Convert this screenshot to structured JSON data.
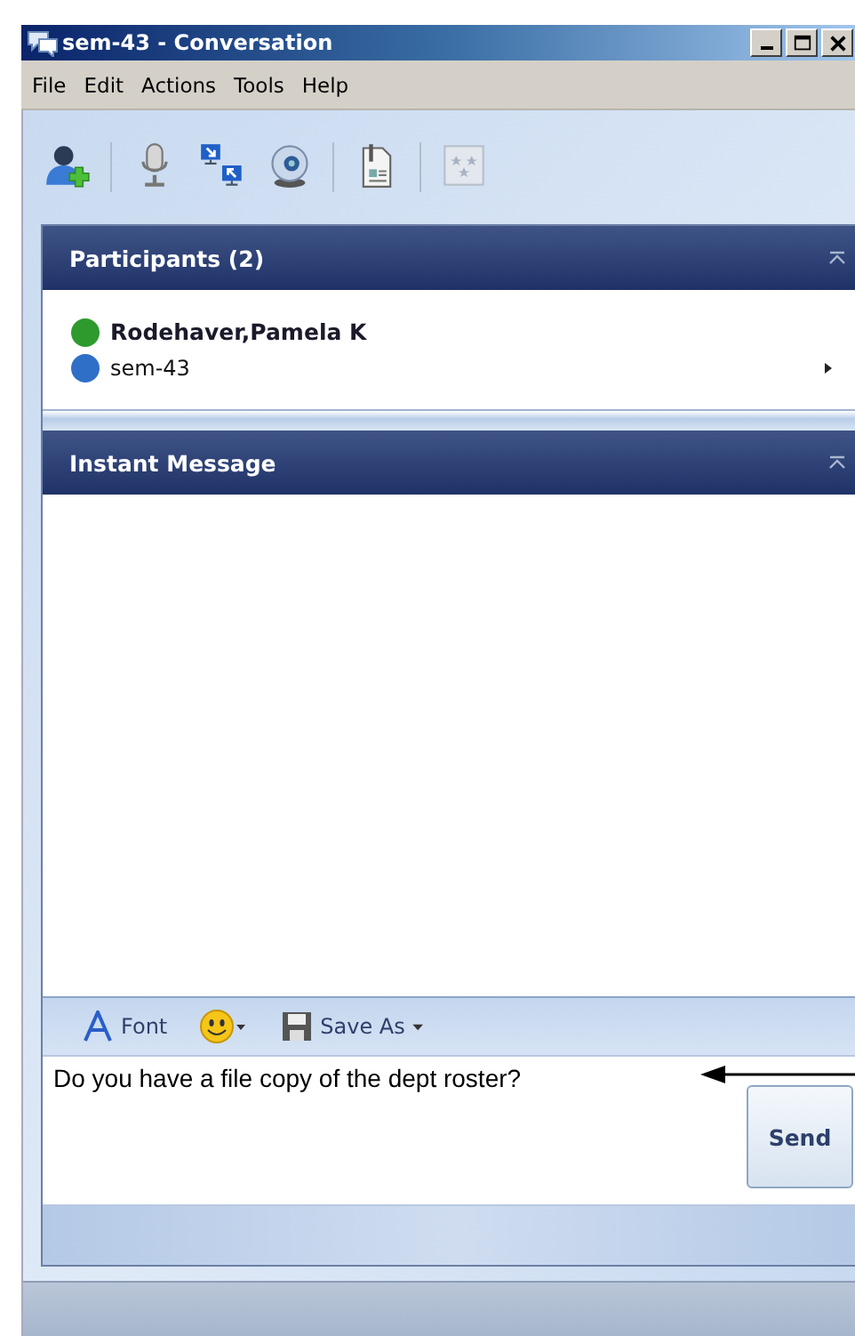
{
  "window": {
    "title": "sem-43 - Conversation"
  },
  "menu": [
    "File",
    "Edit",
    "Actions",
    "Tools",
    "Help"
  ],
  "participants": {
    "title": "Participants (2)",
    "items": [
      {
        "name": "Rodehaver,Pamela K",
        "color": "#2e9a2e",
        "bold": true,
        "has_menu": false
      },
      {
        "name": "sem-43",
        "color": "#2f6fc8",
        "bold": false,
        "has_menu": true
      }
    ]
  },
  "instant_message": {
    "title": "Instant Message"
  },
  "format_bar": {
    "font": "Font",
    "save_as": "Save As"
  },
  "compose": {
    "value": "Do you have a file copy of the dept roster?",
    "send": "Send"
  }
}
